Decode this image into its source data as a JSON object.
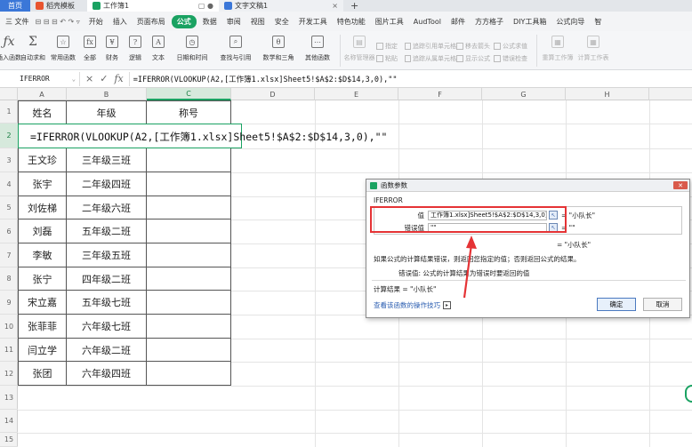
{
  "tabs": {
    "home": "首页",
    "template": "稻壳模板",
    "workbook": "工作簿1",
    "doc": "文字文稿1",
    "plus": "+",
    "ctl": "▢ ●",
    "close": "×"
  },
  "menu": {
    "file": "三 文件",
    "quick": "⊟ ⊟ ⊟ ↶ ↷ ▿",
    "items": [
      "开始",
      "插入",
      "页面布局",
      "公式",
      "数据",
      "审阅",
      "视图",
      "安全",
      "开发工具",
      "特色功能",
      "图片工具",
      "AudTool",
      "邮件",
      "方方格子",
      "DIY工具箱",
      "公式向导",
      "智"
    ]
  },
  "ribbon": {
    "insert_fn": "插入函数",
    "autosum": "自动求和",
    "common": "常用函数",
    "all": "全部",
    "finance": "财务",
    "logic": "逻辑",
    "text": "文本",
    "datetime": "日期和时间",
    "lookup": "查找与引用",
    "math": "数学和三角",
    "other": "其他函数",
    "name_mgr": "名称管理器",
    "define": "指定",
    "paste": "粘贴",
    "trace_prec": "追踪引用单元格",
    "trace_dep": "追踪从属单元格",
    "remove_arrows": "移去箭头",
    "show_formula": "显示公式",
    "formula_eval": "公式求值",
    "error_check": "错误检查",
    "recalc_wb": "重算工作簿",
    "calc_sheet": "计算工作表"
  },
  "formula_bar": {
    "name_box": "IFERROR",
    "cancel": "×",
    "confirm": "✓",
    "fx": "fx",
    "formula": "=IFERROR(VLOOKUP(A2,[工作簿1.xlsx]Sheet5!$A$2:$D$14,3,0),\"\""
  },
  "columns": [
    "A",
    "B",
    "C",
    "D",
    "E",
    "F",
    "G",
    "H"
  ],
  "rows": [
    "1",
    "2",
    "3",
    "4",
    "5",
    "6",
    "7",
    "8",
    "9",
    "10",
    "11",
    "12",
    "13",
    "14",
    "15"
  ],
  "table": {
    "headers": [
      "姓名",
      "年级",
      "称号"
    ],
    "data": [
      [
        "王文珍",
        "三年级三班"
      ],
      [
        "张宇",
        "二年级四班"
      ],
      [
        "刘佐梯",
        "二年级六班"
      ],
      [
        "刘磊",
        "五年级二班"
      ],
      [
        "李敏",
        "三年级五班"
      ],
      [
        "张宁",
        "四年级二班"
      ],
      [
        "宋立嘉",
        "五年级七班"
      ],
      [
        "张菲菲",
        "六年级七班"
      ],
      [
        "闫立学",
        "六年级二班"
      ],
      [
        "张团",
        "六年级四班"
      ]
    ],
    "edit_text": "=IFERROR(VLOOKUP(A2,[工作簿1.xlsx]Sheet5!$A$2:$D$14,3,0),\"\""
  },
  "dialog": {
    "title": "函数参数",
    "close": "✕",
    "fn_name": "IFERROR",
    "arg1_label": "值",
    "arg1_value": "工作簿1.xlsx]Sheet5!$A$2:$D$14,3,0)",
    "arg1_result": "= \"小队长\"",
    "arg2_label": "错误值",
    "arg2_value": "\"\"",
    "arg2_result": "= \"\"",
    "overall_result": "= \"小队长\"",
    "description": "如果公式的计算结果错误，则返回您指定的值；否则返回公式的结果。",
    "arg_desc": "错误值:  公式的计算结果为错误时要返回的值",
    "calc_result": "计算结果 = \"小队长\"",
    "help_link": "查看该函数的操作技巧",
    "ok": "确定",
    "cancel": "取消"
  },
  "colors": {
    "accent_green": "#1aa262",
    "highlight_red": "#e53335",
    "home_blue": "#3b77d8"
  }
}
